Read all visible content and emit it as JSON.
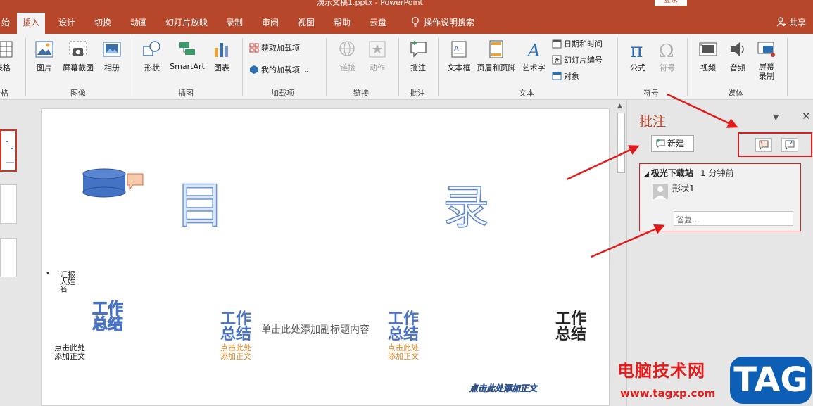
{
  "window": {
    "title": "演示文稿1.pptx - PowerPoint",
    "login": "登录"
  },
  "tabs": [
    "插入",
    "设计",
    "切换",
    "动画",
    "幻灯片放映",
    "录制",
    "审阅",
    "视图",
    "帮助",
    "云盘"
  ],
  "tabs_partial_left": "始",
  "active_tab_index": 0,
  "search_tab": "操作说明搜索",
  "share": "共享",
  "ribbon": {
    "partial_left": {
      "label": "表格",
      "group": "表格"
    },
    "images": {
      "buttons": [
        "图片",
        "屏幕截图",
        "相册"
      ],
      "group": "图像"
    },
    "illustrations": {
      "buttons": [
        "形状",
        "SmartArt",
        "图表"
      ],
      "group": "插图"
    },
    "addins": {
      "items": [
        "获取加载项",
        "我的加载项"
      ],
      "group": "加载项"
    },
    "links": {
      "buttons": [
        "链接",
        "动作"
      ],
      "group": "链接"
    },
    "comments": {
      "buttons": [
        "批注"
      ],
      "group": "批注"
    },
    "text": {
      "buttons": [
        "文本框",
        "页眉和页脚",
        "艺术字"
      ],
      "small": [
        "日期和时间",
        "幻灯片编号",
        "对象"
      ],
      "group": "文本"
    },
    "symbols": {
      "buttons": [
        "公式",
        "符号"
      ],
      "group": "符号"
    },
    "media": {
      "buttons": [
        "视频",
        "音频",
        "屏幕录制"
      ],
      "group": "媒体"
    }
  },
  "slide": {
    "mulu_left": "目",
    "mulu_right": "录",
    "report_label": "汇报人姓名",
    "gz1": "工作总结",
    "gz2": "工作总结",
    "gz3": "工作总结",
    "gz4": "工作总结",
    "subtitle": "单击此处添加副标题内容",
    "click_add_1": "点击此处添加正文",
    "click_add_2": "点击此处添加正文",
    "click_add_3": "点击此处添加正文",
    "click_add_4": "点击此处添加正文"
  },
  "comments_pane": {
    "title": "批注",
    "new_button": "新建",
    "comment": {
      "author": "极光下载站",
      "time": "1 分钟前",
      "text": "形状1"
    },
    "reply_placeholder": "答复..."
  },
  "watermark": {
    "text": "电脑技术网",
    "url": "www.tagxp.com",
    "tag": "TAG"
  },
  "colors": {
    "brand": "#b7472a",
    "highlight": "#d62020",
    "blue": "#4a72c2",
    "orange": "#e08a26"
  }
}
